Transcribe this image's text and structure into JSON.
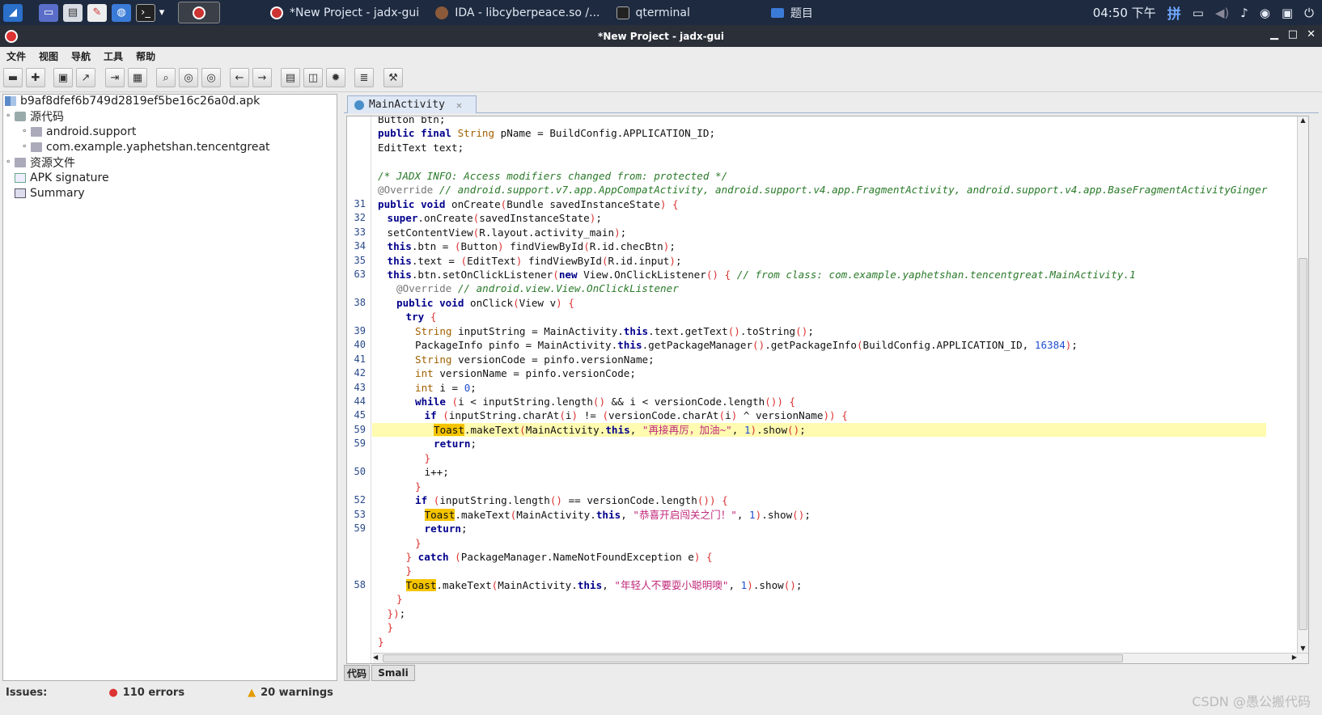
{
  "taskbar": {
    "tasks": [
      {
        "label": "*New Project - jadx-gui",
        "icon": "jadx-icon"
      },
      {
        "label": "IDA - libcyberpeace.so /...",
        "icon": "ida-icon"
      },
      {
        "label": "qterminal",
        "icon": "terminal-icon"
      },
      {
        "label": "题目",
        "icon": "folder-icon"
      }
    ],
    "clock": "04:50 下午",
    "ime": "拼"
  },
  "window": {
    "title": "*New Project - jadx-gui"
  },
  "menu": [
    "文件",
    "视图",
    "导航",
    "工具",
    "帮助"
  ],
  "tree": {
    "root": "b9af8dfef6b749d2819ef5be16c26a0d.apk",
    "source_label": "源代码",
    "packages": [
      "android.support",
      "com.example.yaphetshan.tencentgreat"
    ],
    "resources_label": "资源文件",
    "apk_signature_label": "APK signature",
    "summary_label": "Summary"
  },
  "status": {
    "issues_label": "Issues:",
    "errors": "110 errors",
    "warnings": "20 warnings"
  },
  "editor": {
    "tab_label": "MainActivity",
    "bottom_tabs": [
      "代码",
      "Smali"
    ],
    "lines": [
      {
        "n": "",
        "ind": 0,
        "t": [
          [
            "p",
            "Button btn;"
          ]
        ]
      },
      {
        "n": "",
        "ind": 0,
        "t": [
          [
            "k",
            "public final "
          ],
          [
            "y",
            "String "
          ],
          [
            "p",
            "pName = BuildConfig.APPLICATION_ID;"
          ]
        ]
      },
      {
        "n": "",
        "ind": 0,
        "t": [
          [
            "p",
            "EditText text;"
          ]
        ]
      },
      {
        "n": "",
        "ind": 0,
        "t": []
      },
      {
        "n": "",
        "ind": 0,
        "t": [
          [
            "c",
            "/* JADX INFO: Access modifiers changed from: protected */"
          ]
        ]
      },
      {
        "n": "",
        "ind": 0,
        "t": [
          [
            "a",
            "@Override "
          ],
          [
            "c",
            "// android.support.v7.app.AppCompatActivity, android.support.v4.app.FragmentActivity, android.support.v4.app.BaseFragmentActivityGinger"
          ]
        ]
      },
      {
        "n": "31",
        "ind": 0,
        "t": [
          [
            "k",
            "public void "
          ],
          [
            "p",
            "onCreate"
          ],
          [
            "r",
            "("
          ],
          [
            "p",
            "Bundle savedInstanceState"
          ],
          [
            "r",
            ") {"
          ]
        ]
      },
      {
        "n": "32",
        "ind": 1,
        "t": [
          [
            "k",
            "super"
          ],
          [
            "p",
            ".onCreate"
          ],
          [
            "r",
            "("
          ],
          [
            "p",
            "savedInstanceState"
          ],
          [
            "r",
            ")"
          ],
          [
            "p",
            ";"
          ]
        ]
      },
      {
        "n": "33",
        "ind": 1,
        "t": [
          [
            "p",
            "setContentView"
          ],
          [
            "r",
            "("
          ],
          [
            "p",
            "R.layout.activity_main"
          ],
          [
            "r",
            ")"
          ],
          [
            "p",
            ";"
          ]
        ]
      },
      {
        "n": "34",
        "ind": 1,
        "t": [
          [
            "k",
            "this"
          ],
          [
            "p",
            ".btn = "
          ],
          [
            "r",
            "("
          ],
          [
            "p",
            "Button"
          ],
          [
            "r",
            ") "
          ],
          [
            "p",
            "findViewById"
          ],
          [
            "r",
            "("
          ],
          [
            "p",
            "R.id.checBtn"
          ],
          [
            "r",
            ")"
          ],
          [
            "p",
            ";"
          ]
        ]
      },
      {
        "n": "35",
        "ind": 1,
        "t": [
          [
            "k",
            "this"
          ],
          [
            "p",
            ".text = "
          ],
          [
            "r",
            "("
          ],
          [
            "p",
            "EditText"
          ],
          [
            "r",
            ") "
          ],
          [
            "p",
            "findViewById"
          ],
          [
            "r",
            "("
          ],
          [
            "p",
            "R.id.input"
          ],
          [
            "r",
            ")"
          ],
          [
            "p",
            ";"
          ]
        ]
      },
      {
        "n": "63",
        "ind": 1,
        "t": [
          [
            "k",
            "this"
          ],
          [
            "p",
            ".btn.setOnClickListener"
          ],
          [
            "r",
            "("
          ],
          [
            "k",
            "new "
          ],
          [
            "p",
            "View.OnClickListener"
          ],
          [
            "r",
            "() { "
          ],
          [
            "c",
            "// from class: com.example.yaphetshan.tencentgreat.MainActivity.1"
          ]
        ]
      },
      {
        "n": "",
        "ind": 2,
        "t": [
          [
            "a",
            "@Override "
          ],
          [
            "c",
            "// android.view.View.OnClickListener"
          ]
        ]
      },
      {
        "n": "38",
        "ind": 2,
        "t": [
          [
            "k",
            "public void "
          ],
          [
            "p",
            "onClick"
          ],
          [
            "r",
            "("
          ],
          [
            "p",
            "View v"
          ],
          [
            "r",
            ") {"
          ]
        ]
      },
      {
        "n": "",
        "ind": 3,
        "t": [
          [
            "k",
            "try "
          ],
          [
            "r",
            "{"
          ]
        ]
      },
      {
        "n": "39",
        "ind": 4,
        "t": [
          [
            "y",
            "String "
          ],
          [
            "p",
            "inputString = MainActivity."
          ],
          [
            "k",
            "this"
          ],
          [
            "p",
            ".text.getText"
          ],
          [
            "r",
            "()"
          ],
          [
            "p",
            ".toString"
          ],
          [
            "r",
            "()"
          ],
          [
            "p",
            ";"
          ]
        ]
      },
      {
        "n": "40",
        "ind": 4,
        "t": [
          [
            "p",
            "PackageInfo pinfo = MainActivity."
          ],
          [
            "k",
            "this"
          ],
          [
            "p",
            ".getPackageManager"
          ],
          [
            "r",
            "()"
          ],
          [
            "p",
            ".getPackageInfo"
          ],
          [
            "r",
            "("
          ],
          [
            "p",
            "BuildConfig.APPLICATION_ID, "
          ],
          [
            "n",
            "16384"
          ],
          [
            "r",
            ")"
          ],
          [
            "p",
            ";"
          ]
        ]
      },
      {
        "n": "41",
        "ind": 4,
        "t": [
          [
            "y",
            "String "
          ],
          [
            "p",
            "versionCode = pinfo.versionName;"
          ]
        ]
      },
      {
        "n": "42",
        "ind": 4,
        "t": [
          [
            "y",
            "int "
          ],
          [
            "p",
            "versionName = pinfo.versionCode;"
          ]
        ]
      },
      {
        "n": "43",
        "ind": 4,
        "t": [
          [
            "y",
            "int "
          ],
          [
            "p",
            "i = "
          ],
          [
            "n",
            "0"
          ],
          [
            "p",
            ";"
          ]
        ]
      },
      {
        "n": "44",
        "ind": 4,
        "t": [
          [
            "k",
            "while "
          ],
          [
            "r",
            "("
          ],
          [
            "p",
            "i < inputString.length"
          ],
          [
            "r",
            "() "
          ],
          [
            "p",
            "&& i < versionCode.length"
          ],
          [
            "r",
            "()) {"
          ]
        ]
      },
      {
        "n": "45",
        "ind": 5,
        "t": [
          [
            "k",
            "if "
          ],
          [
            "r",
            "("
          ],
          [
            "p",
            "inputString.charAt"
          ],
          [
            "r",
            "("
          ],
          [
            "p",
            "i"
          ],
          [
            "r",
            ") "
          ],
          [
            "p",
            "!= "
          ],
          [
            "r",
            "("
          ],
          [
            "p",
            "versionCode.charAt"
          ],
          [
            "r",
            "("
          ],
          [
            "p",
            "i"
          ],
          [
            "r",
            ") "
          ],
          [
            "p",
            "^ versionName"
          ],
          [
            "r",
            ")) {"
          ]
        ]
      },
      {
        "n": "59",
        "ind": 6,
        "hl": true,
        "t": [
          [
            "T",
            "Toast"
          ],
          [
            "p",
            ".makeText"
          ],
          [
            "r",
            "("
          ],
          [
            "p",
            "MainActivity."
          ],
          [
            "k",
            "this"
          ],
          [
            "p",
            ", "
          ],
          [
            "s",
            "\"再接再厉，加油~\""
          ],
          [
            "p",
            ", "
          ],
          [
            "n",
            "1"
          ],
          [
            "r",
            ")"
          ],
          [
            "p",
            ".show"
          ],
          [
            "r",
            "()"
          ],
          [
            "p",
            ";"
          ]
        ]
      },
      {
        "n": "59",
        "ind": 6,
        "t": [
          [
            "k",
            "return"
          ],
          [
            "p",
            ";"
          ]
        ]
      },
      {
        "n": "",
        "ind": 5,
        "t": [
          [
            "r",
            "}"
          ]
        ]
      },
      {
        "n": "50",
        "ind": 5,
        "t": [
          [
            "p",
            "i++;"
          ]
        ]
      },
      {
        "n": "",
        "ind": 4,
        "t": [
          [
            "r",
            "}"
          ]
        ]
      },
      {
        "n": "52",
        "ind": 4,
        "t": [
          [
            "k",
            "if "
          ],
          [
            "r",
            "("
          ],
          [
            "p",
            "inputString.length"
          ],
          [
            "r",
            "() "
          ],
          [
            "p",
            "== versionCode.length"
          ],
          [
            "r",
            "()) {"
          ]
        ]
      },
      {
        "n": "53",
        "ind": 5,
        "t": [
          [
            "T",
            "Toast"
          ],
          [
            "p",
            ".makeText"
          ],
          [
            "r",
            "("
          ],
          [
            "p",
            "MainActivity."
          ],
          [
            "k",
            "this"
          ],
          [
            "p",
            ", "
          ],
          [
            "s",
            "\"恭喜开启闯关之门！\""
          ],
          [
            "p",
            ", "
          ],
          [
            "n",
            "1"
          ],
          [
            "r",
            ")"
          ],
          [
            "p",
            ".show"
          ],
          [
            "r",
            "()"
          ],
          [
            "p",
            ";"
          ]
        ]
      },
      {
        "n": "59",
        "ind": 5,
        "t": [
          [
            "k",
            "return"
          ],
          [
            "p",
            ";"
          ]
        ]
      },
      {
        "n": "",
        "ind": 4,
        "t": [
          [
            "r",
            "}"
          ]
        ]
      },
      {
        "n": "",
        "ind": 3,
        "t": [
          [
            "r",
            "} "
          ],
          [
            "k",
            "catch "
          ],
          [
            "r",
            "("
          ],
          [
            "p",
            "PackageManager.NameNotFoundException e"
          ],
          [
            "r",
            ") {"
          ]
        ]
      },
      {
        "n": "",
        "ind": 3,
        "t": [
          [
            "r",
            "}"
          ]
        ]
      },
      {
        "n": "58",
        "ind": 3,
        "t": [
          [
            "T",
            "Toast"
          ],
          [
            "p",
            ".makeText"
          ],
          [
            "r",
            "("
          ],
          [
            "p",
            "MainActivity."
          ],
          [
            "k",
            "this"
          ],
          [
            "p",
            ", "
          ],
          [
            "s",
            "\"年轻人不要耍小聪明噢\""
          ],
          [
            "p",
            ", "
          ],
          [
            "n",
            "1"
          ],
          [
            "r",
            ")"
          ],
          [
            "p",
            ".show"
          ],
          [
            "r",
            "()"
          ],
          [
            "p",
            ";"
          ]
        ]
      },
      {
        "n": "",
        "ind": 2,
        "t": [
          [
            "r",
            "}"
          ]
        ]
      },
      {
        "n": "",
        "ind": 1,
        "t": [
          [
            "r",
            "})"
          ],
          [
            "p",
            ";"
          ]
        ]
      },
      {
        "n": "",
        "ind": 1,
        "t": [
          [
            "r",
            "}"
          ]
        ]
      },
      {
        "n": "",
        "ind": 0,
        "t": [
          [
            "r",
            "}"
          ]
        ]
      }
    ]
  },
  "watermark": "CSDN @愚公搬代码"
}
